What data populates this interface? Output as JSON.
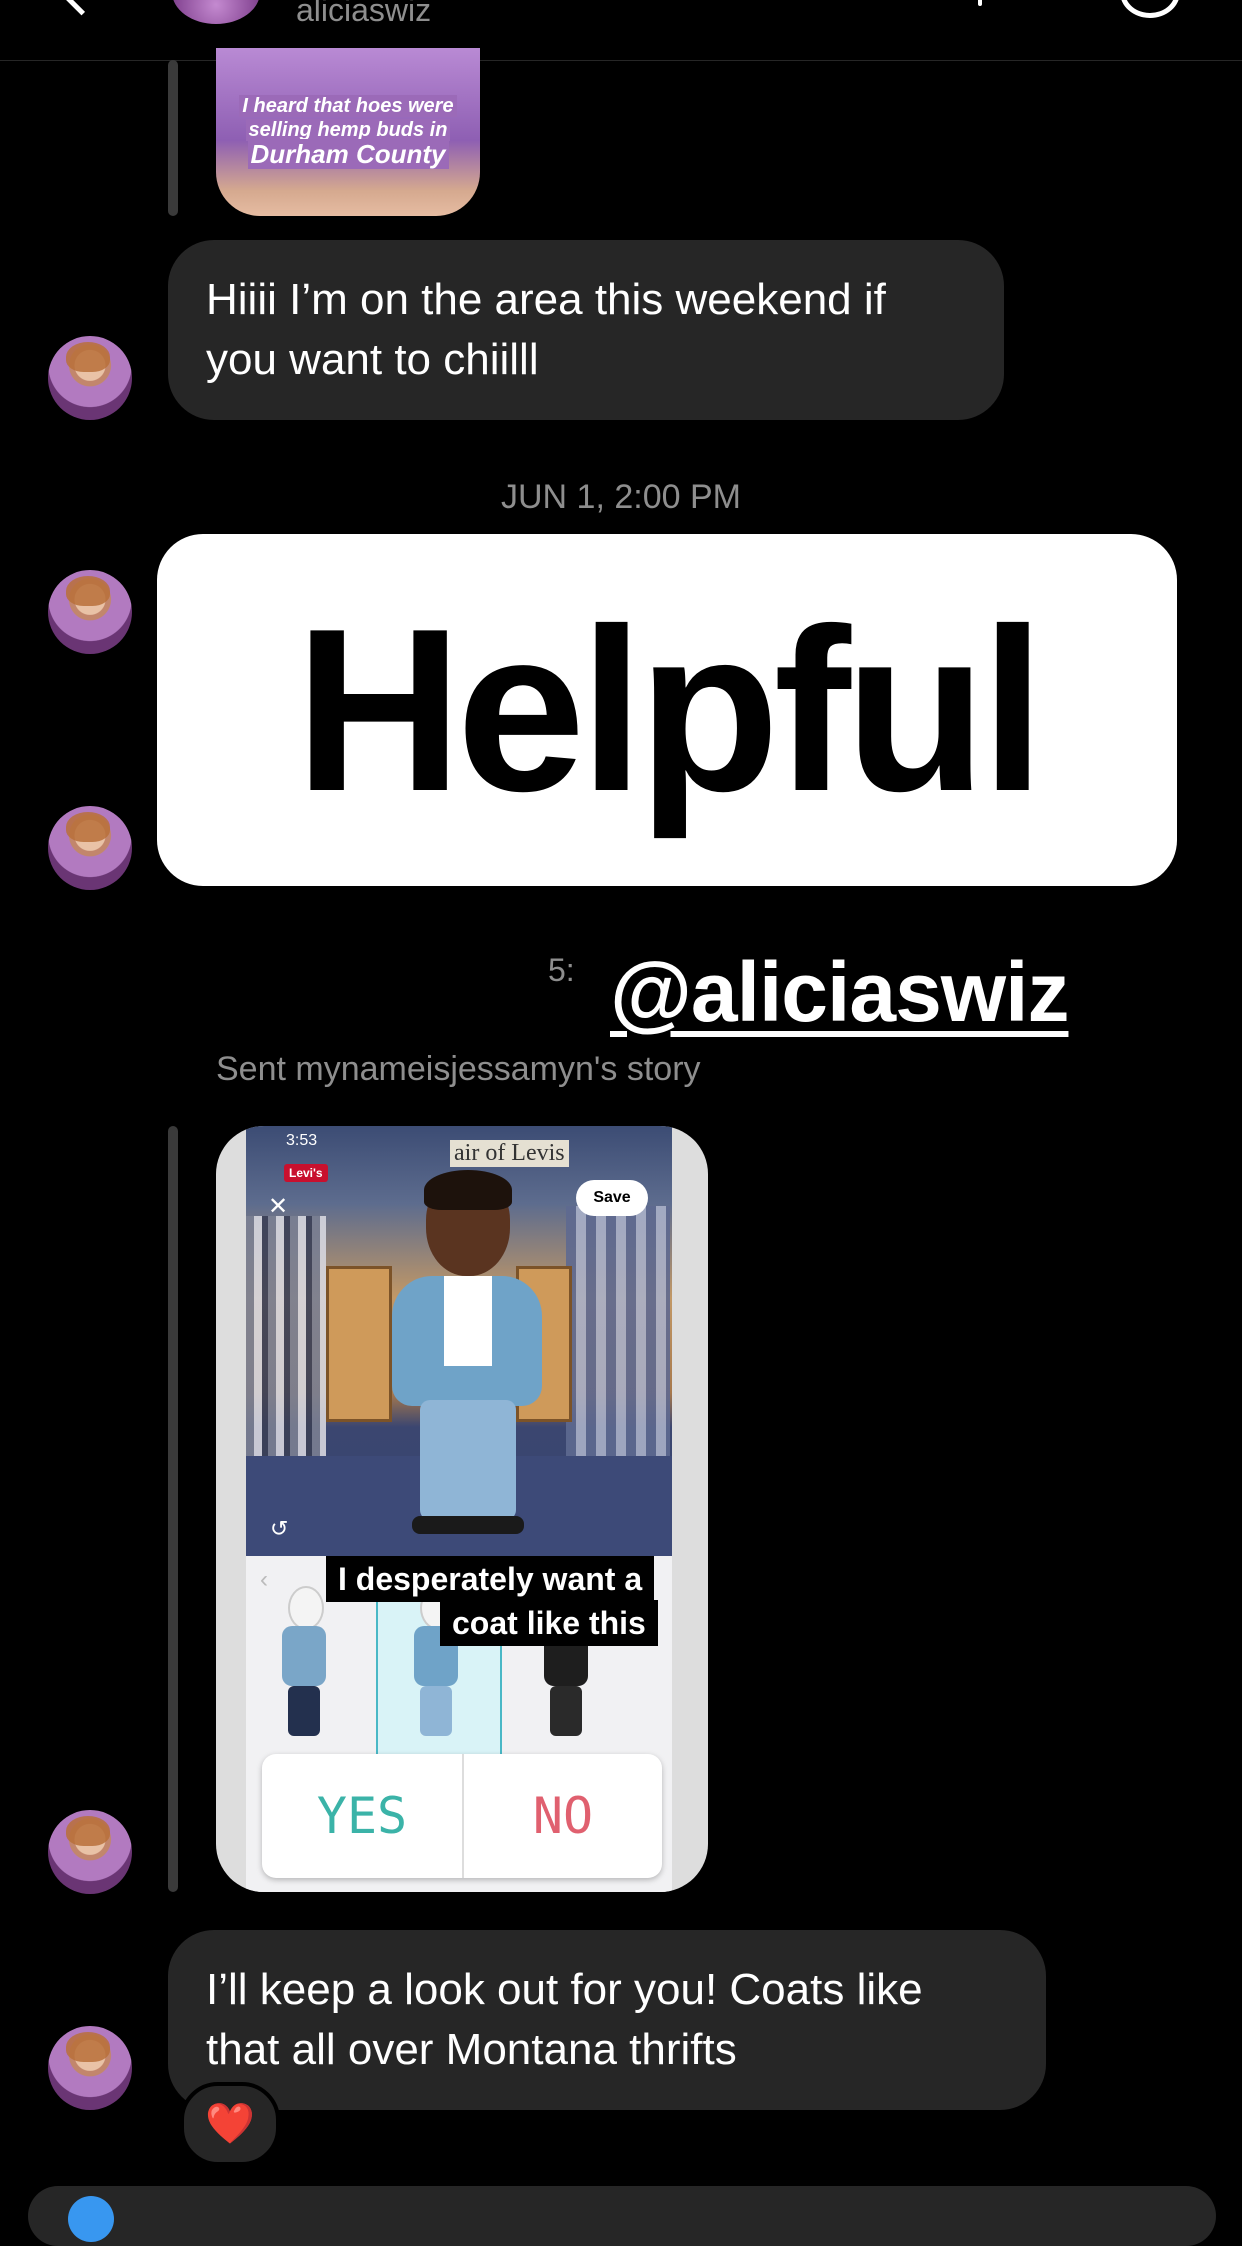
{
  "header": {
    "username": "aliciaswiz"
  },
  "story_top": {
    "caption_line1": "I heard that hoes were",
    "caption_line2": "selling hemp buds in",
    "caption_line3": "Durham County"
  },
  "messages": {
    "msg1": "Hiiii I’m on the area this weekend if you want to chiilll",
    "timestamp": "JUN 1, 2:00 PM",
    "sticker_text": "Helpful",
    "time_partial": "5:",
    "mention": "@aliciaswiz",
    "sent_story_label": "Sent mynameisjessamyn's story",
    "msg2": "I’ll keep a look out for you! Coats like that all over Montana thrifts",
    "reaction": "❤️"
  },
  "story_card": {
    "status_time": "3:53",
    "brand": "Levi's",
    "sign": "air of Levis",
    "save_label": "Save",
    "caption_line1": "I desperately want a",
    "caption_line2": "coat like this",
    "poll_yes": "YES",
    "poll_no": "NO"
  }
}
